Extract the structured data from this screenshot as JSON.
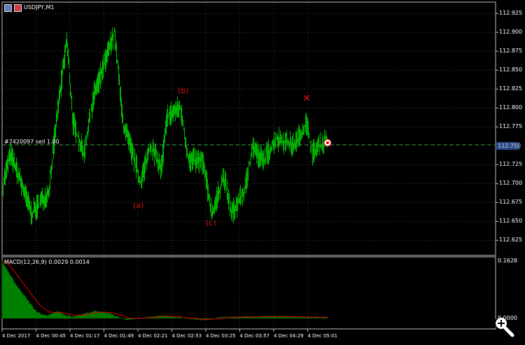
{
  "window": {
    "symbol_title": "USDJPY,M1"
  },
  "trade_line": {
    "label": "#7420097 sell 1.00",
    "price": 112.75
  },
  "current_price_label": "112.750",
  "indicator": {
    "label": "MACD(12,26,9) 0.0029 0.0014",
    "axis_max_label": "0.1628",
    "axis_zero_label": "0.0000"
  },
  "annotations": {
    "a": "(a)",
    "b": "(b)",
    "c": "(c)",
    "x": "✕"
  },
  "colors": {
    "candles": "#00c000",
    "macd_hist": "#008000",
    "signal": "#e00000",
    "grid": "#404040",
    "annotation": "#e01010",
    "trade_line": "#40a040"
  },
  "chart_data": {
    "type": "line",
    "title": "USDJPY,M1",
    "ylim": [
      112.605,
      112.94
    ],
    "y_ticks": [
      "112.925",
      "112.900",
      "112.875",
      "112.850",
      "112.825",
      "112.800",
      "112.775",
      "112.725",
      "112.700",
      "112.675",
      "112.650",
      "112.625"
    ],
    "x_ticks": [
      "4 Dec 2017",
      "4 Dec 00:45",
      "4 Dec 01:17",
      "4 Dec 01:49",
      "4 Dec 02:21",
      "4 Dec 02:53",
      "4 Dec 03:25",
      "4 Dec 03:57",
      "4 Dec 04:29",
      "4 Dec 05:01"
    ],
    "price_keypoints": [
      [
        "00:14",
        112.7
      ],
      [
        "00:21",
        112.74
      ],
      [
        "00:41",
        112.66
      ],
      [
        "00:57",
        112.69
      ],
      [
        "01:04",
        112.78
      ],
      [
        "01:14",
        112.89
      ],
      [
        "01:20",
        112.78
      ],
      [
        "01:30",
        112.74
      ],
      [
        "01:40",
        112.82
      ],
      [
        "01:50",
        112.86
      ],
      [
        "01:59",
        112.9
      ],
      [
        "02:07",
        112.78
      ],
      [
        "02:20",
        112.72
      ],
      [
        "02:23",
        112.7
      ],
      [
        "02:33",
        112.75
      ],
      [
        "02:43",
        112.72
      ],
      [
        "02:49",
        112.79
      ],
      [
        "03:01",
        112.8
      ],
      [
        "03:09",
        112.73
      ],
      [
        "03:22",
        112.73
      ],
      [
        "03:31",
        112.66
      ],
      [
        "03:42",
        112.71
      ],
      [
        "03:49",
        112.66
      ],
      [
        "04:02",
        112.69
      ],
      [
        "04:09",
        112.75
      ],
      [
        "04:19",
        112.73
      ],
      [
        "04:32",
        112.76
      ],
      [
        "04:48",
        112.75
      ],
      [
        "05:00",
        112.78
      ],
      [
        "05:05",
        112.74
      ],
      [
        "05:20",
        112.76
      ]
    ],
    "macd_ylim": [
      -0.01,
      0.1628
    ],
    "macd_keypoints": [
      [
        "00:13",
        0.16
      ],
      [
        "00:25",
        0.1
      ],
      [
        "00:45",
        0.02
      ],
      [
        "00:55",
        0.006
      ],
      [
        "01:05",
        0.02
      ],
      [
        "01:12",
        0.01
      ],
      [
        "01:20",
        0.005
      ],
      [
        "01:40",
        0.02
      ],
      [
        "01:55",
        0.014
      ],
      [
        "02:10",
        -0.005
      ],
      [
        "02:25",
        0.002
      ],
      [
        "02:45",
        0.008
      ],
      [
        "03:00",
        0.002
      ],
      [
        "03:20",
        -0.005
      ],
      [
        "03:40",
        0.003
      ],
      [
        "04:00",
        0.004
      ],
      [
        "04:30",
        0.006
      ],
      [
        "05:00",
        0.003
      ],
      [
        "05:20",
        0.0029
      ]
    ]
  }
}
